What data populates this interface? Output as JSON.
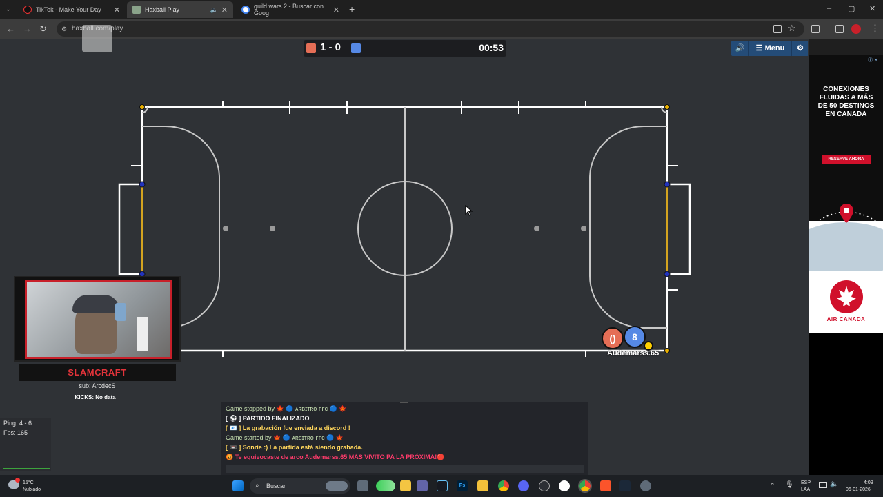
{
  "browser": {
    "tabs": [
      {
        "label": "TikTok - Make Your Day",
        "active": false
      },
      {
        "label": "Haxball Play",
        "active": true
      },
      {
        "label": "guild wars 2 - Buscar con Goog",
        "active": false
      }
    ],
    "new_tab_label": "+",
    "url": "haxball.com/play",
    "window_controls": [
      "–",
      "▢",
      "✕"
    ]
  },
  "game": {
    "score": "1 - 0",
    "timer": "00:53",
    "team_colors": {
      "red": "#e56e56",
      "blue": "#5689e5"
    },
    "menu_label": "☰ Menu",
    "sound_icon": "speaker-icon",
    "settings_icon": "gear-icon",
    "players": [
      {
        "label": "()",
        "team": "red"
      },
      {
        "label": "8",
        "team": "blue"
      }
    ],
    "player_name": "Audemarss.65"
  },
  "overlay": {
    "streamer_name": "SLAMCRAFT",
    "subline": "sub: ArcdecS",
    "kicks": "KICKS: No data"
  },
  "stats": {
    "ping": "Ping: 4 - 6",
    "fps": "Fps: 165"
  },
  "chat": {
    "messages": [
      {
        "text": "Game stopped by 🍁 🔵 ᴀʀʙɪᴛʀᴏ ꜰꜰᴄ 🔵 🍁",
        "color": "#c9e2b3",
        "bold": false
      },
      {
        "text": "[ ⚽ ] PARTIDO FINALIZADO",
        "color": "#ffffff",
        "bold": true
      },
      {
        "text": "[ 📧 ] La grabación fue enviada a discord !",
        "color": "#ffd65c",
        "bold": true
      },
      {
        "text": "Game started by 🍁 🔵 ᴀʀʙɪᴛʀᴏ ꜰꜰᴄ 🔵 🍁",
        "color": "#c9e2b3",
        "bold": false
      },
      {
        "text": "[ 📼 ] Sonríe :) La partida está siendo grabada.",
        "color": "#ffd65c",
        "bold": true
      },
      {
        "text": "😡 Te equivocaste de arco Audemarss.65 MÁS VIVITO PA LA PRÓXIMA!🔴",
        "color": "#ff3b6b",
        "bold": true
      }
    ]
  },
  "ad": {
    "title": "CONEXIONES FLUIDAS A MÁS DE 50 DESTINOS EN CANADÁ",
    "cta": "RESERVE AHORA",
    "brand": "AIR CANADA"
  },
  "taskbar": {
    "weather_temp": "15°C",
    "weather_desc": "Nublado",
    "search_placeholder": "Buscar",
    "lang_top": "ESP",
    "lang_bottom": "LAA",
    "time": "4:09",
    "date": "06-01-2026"
  }
}
